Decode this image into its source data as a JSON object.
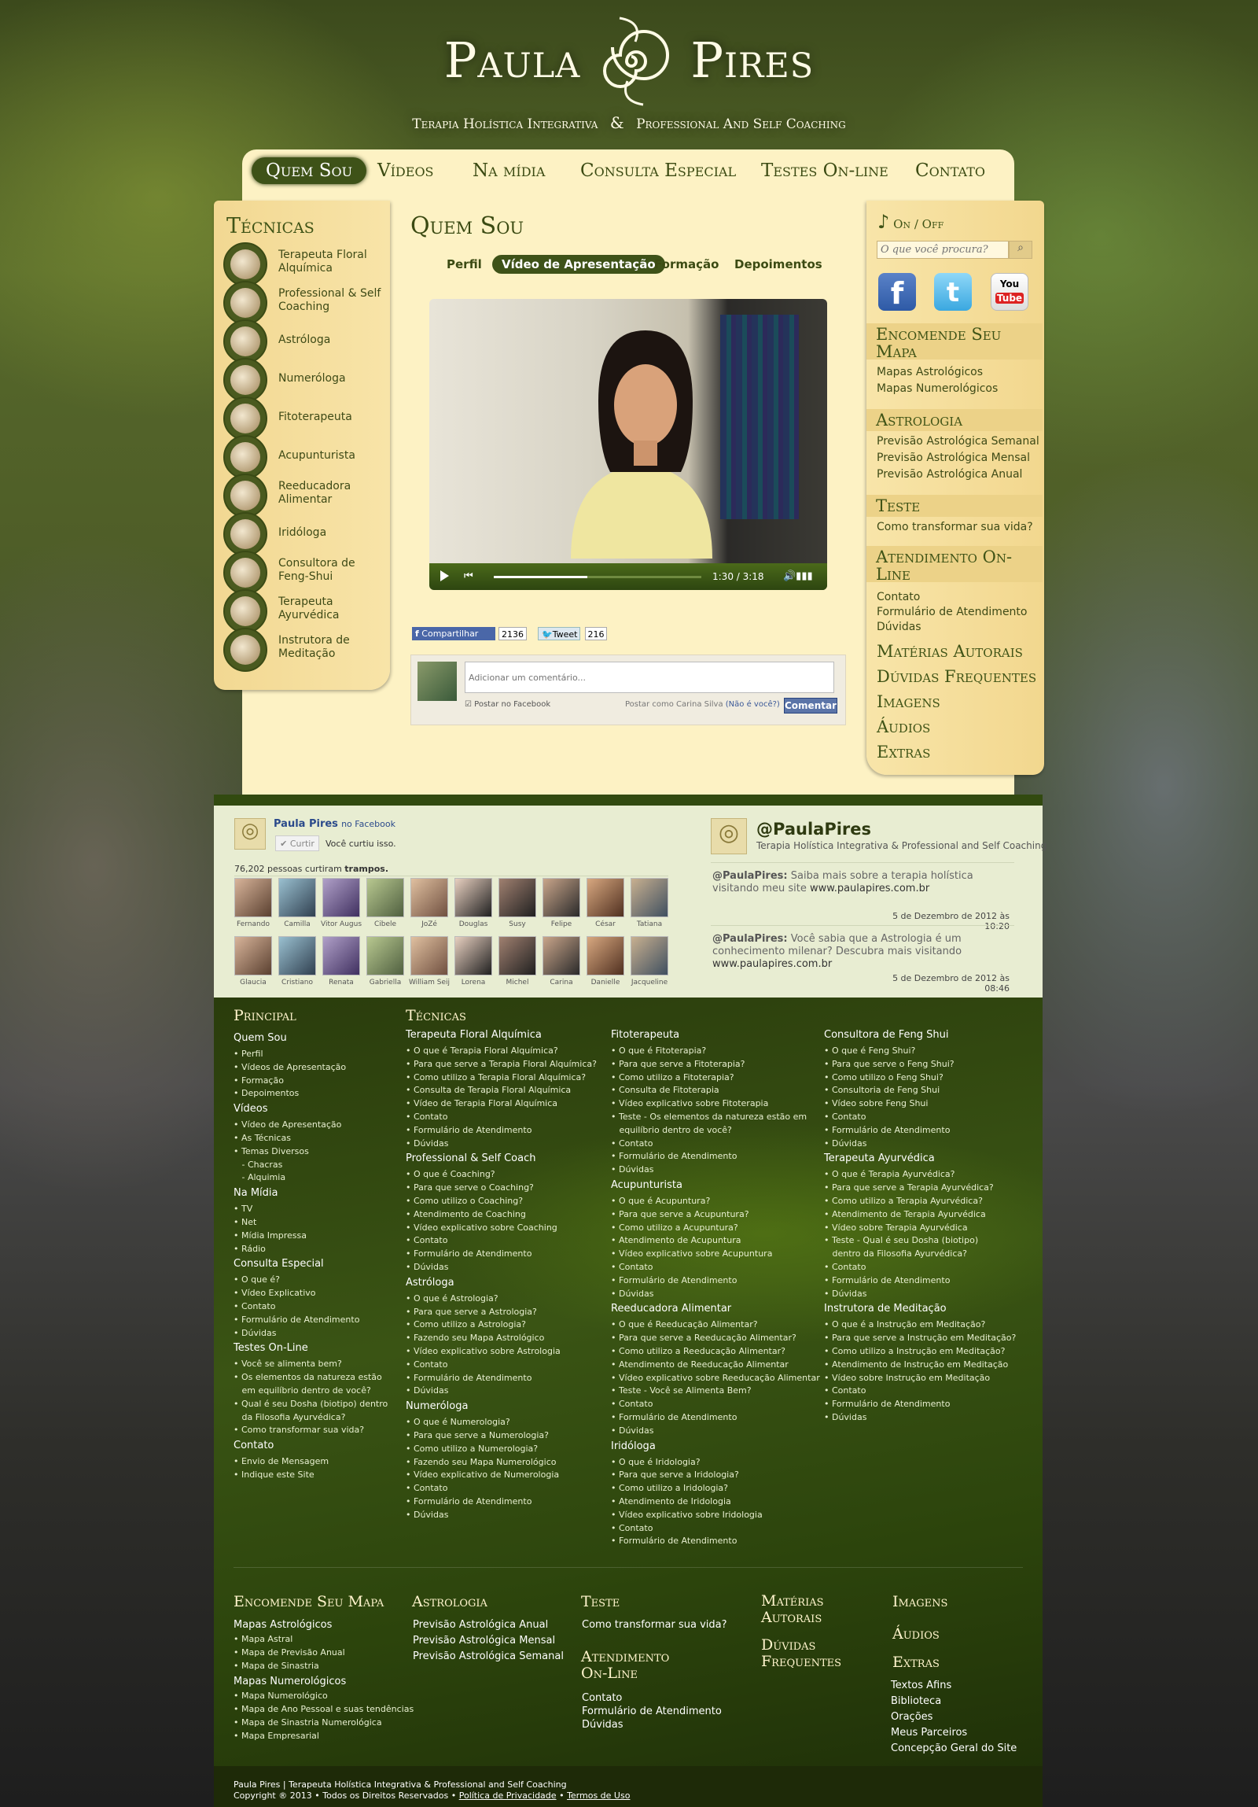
{
  "header": {
    "brand_left": "Paula",
    "brand_right": "Pires",
    "tagline_left": "Terapia Holística Integrativa",
    "tagline_amp": "&",
    "tagline_right": "Professional And Self Coaching"
  },
  "nav": {
    "items": [
      "Quem Sou",
      "Vídeos",
      "Na mídia",
      "Consulta Especial",
      "Testes On-line",
      "Contato"
    ]
  },
  "left_sidebar": {
    "title": "Técnicas",
    "items": [
      "Terapeuta Floral Alquímica",
      "Professional & Self Coaching",
      "Astróloga",
      "Numeróloga",
      "Fitoterapeuta",
      "Acupunturista",
      "Reeducadora Alimentar",
      "Iridóloga",
      "Consultora de Feng-Shui",
      "Terapeuta Ayurvédica",
      "Instrutora de Meditação"
    ]
  },
  "main": {
    "title": "Quem Sou",
    "tabs": [
      "Perfil",
      "Vídeo de Apresentação",
      "Formação",
      "Depoimentos"
    ],
    "video_time": "1:30 / 3:18",
    "video_progress": 0.45,
    "share_label": "Compartilhar",
    "share_count": "2136",
    "tweet_label": "Tweet",
    "tweet_count": "216",
    "comment_placeholder": "Adicionar um comentário...",
    "post_fb": "Postar no Facebook",
    "post_as": "Postar como Carina Silva",
    "not_you": "(Não é você?)",
    "comment_button": "Comentar"
  },
  "right_sidebar": {
    "music_on": "On",
    "music_sep": "/",
    "music_off": "Off",
    "search_placeholder": "O que você procura?",
    "sections": [
      {
        "title": "Encomende Seu Mapa",
        "links": [
          "Mapas Astrológicos",
          "Mapas Numerológicos"
        ]
      },
      {
        "title": "Astrologia",
        "links": [
          "Previsão Astrológica Semanal",
          "Previsão Astrológica Mensal",
          "Previsão Astrológica Anual"
        ]
      },
      {
        "title": "Teste",
        "links": [
          "Como transformar sua vida?"
        ]
      },
      {
        "title": "Atendimento On-Line",
        "links": [
          "Contato",
          "Formulário de Atendimento",
          "Dúvidas"
        ]
      }
    ],
    "big_links": [
      "Matérias Autorais",
      "Dúvidas Frequentes",
      "Imagens",
      "Áudios",
      "Extras"
    ]
  },
  "facebook": {
    "page": "Paula Pires",
    "on": "no Facebook",
    "like": "Curtir",
    "liked": "Você curtiu isso.",
    "count_text": "76,202 pessoas curtiram",
    "count_bold": "trampos.",
    "people": [
      "Fernando",
      "Camilla",
      "Vitor Augus",
      "Cibele",
      "JoZé",
      "Douglas",
      "Susy",
      "Felipe",
      "César",
      "Tatiana",
      "Glaucia",
      "Cristiano",
      "Renata",
      "Gabriella",
      "William Seij",
      "Lorena",
      "Michel",
      "Carina",
      "Danielle",
      "Jacqueline"
    ]
  },
  "twitter": {
    "handle": "@PaulaPires",
    "desc": "Terapia Holística Integrativa & Professional and Self Coaching",
    "tweets": [
      {
        "user": "@PaulaPires:",
        "text": "Saiba mais sobre a terapia holística visitando meu site",
        "link": "www.paulapires.com.br",
        "date": "5 de Dezembro de 2012 às 10:20"
      },
      {
        "user": "@PaulaPires:",
        "text": "Você sabia que a Astrologia é um conhecimento milenar? Descubra mais visitando",
        "link": "www.paulapires.com.br",
        "date": "5 de Dezembro de 2012 às 08:46"
      }
    ]
  },
  "footer": {
    "principal_title": "Principal",
    "tecnicas_title": "Técnicas",
    "principal": [
      {
        "h": "Quem Sou",
        "l": [
          "• Perfil",
          "• Vídeos de Apresentação",
          "• Formação",
          "• Depoimentos"
        ]
      },
      {
        "h": "Vídeos",
        "l": [
          "• Vídeo de Apresentação",
          "• As Técnicas",
          "• Temas Diversos",
          "   - Chacras",
          "   - Alquimia"
        ]
      },
      {
        "h": "Na Mídia",
        "l": [
          "• TV",
          "• Net",
          "• Mídia Impressa",
          "• Rádio"
        ]
      },
      {
        "h": "Consulta Especial",
        "l": [
          "• O que é?",
          "• Vídeo Explicativo",
          "• Contato",
          "• Formulário de Atendimento",
          "• Dúvidas"
        ]
      },
      {
        "h": "Testes On-Line",
        "l": [
          "• Você se alimenta bem?",
          "• Os elementos da natureza estão",
          "   em equilíbrio dentro de você?",
          "• Qual é seu Dosha (biotipo) dentro",
          "   da Filosofia Ayurvédica?",
          "• Como transformar sua vida?"
        ]
      },
      {
        "h": "Contato",
        "l": [
          "• Envio de Mensagem",
          "• Indique este Site"
        ]
      }
    ],
    "col1": [
      {
        "h": "Terapeuta Floral Alquímica",
        "l": [
          "• O que é Terapia Floral Alquímica?",
          "• Para que serve a Terapia Floral Alquímica?",
          "• Como utilizo a Terapia Floral Alquímica?",
          "• Consulta de Terapia Floral Alquímica",
          "• Vídeo de Terapia Floral Alquímica",
          "• Contato",
          "• Formulário de Atendimento",
          "• Dúvidas"
        ]
      },
      {
        "h": "Professional & Self Coach",
        "l": [
          "• O que é Coaching?",
          "• Para que serve o Coaching?",
          "• Como utilizo o Coaching?",
          "• Atendimento de Coaching",
          "• Vídeo explicativo sobre Coaching",
          "• Contato",
          "• Formulário de Atendimento",
          "• Dúvidas"
        ]
      },
      {
        "h": "Astróloga",
        "l": [
          "• O que é Astrologia?",
          "• Para que serve a Astrologia?",
          "• Como utilizo a Astrologia?",
          "• Fazendo seu Mapa Astrológico",
          "• Vídeo explicativo sobre Astrologia",
          "• Contato",
          "• Formulário de Atendimento",
          "• Dúvidas"
        ]
      },
      {
        "h": "Numeróloga",
        "l": [
          "• O que é Numerologia?",
          "• Para que serve a Numerologia?",
          "• Como utilizo a Numerologia?",
          "• Fazendo seu Mapa Numerológico",
          "• Vídeo explicativo de Numerologia",
          "• Contato",
          "• Formulário de Atendimento",
          "• Dúvidas"
        ]
      }
    ],
    "col2": [
      {
        "h": "Fitoterapeuta",
        "l": [
          "• O que é Fitoterapia?",
          "• Para que serve a Fitoterapia?",
          "• Como utilizo a Fitoterapia?",
          "• Consulta de Fitoterapia",
          "• Vídeo explicativo sobre Fitoterapia",
          "• Teste - Os elementos da natureza estão em",
          "   equilíbrio dentro de você?",
          "• Contato",
          "• Formulário de Atendimento",
          "• Dúvidas"
        ]
      },
      {
        "h": "Acupunturista",
        "l": [
          "• O que é Acupuntura?",
          "• Para que serve a Acupuntura?",
          "• Como utilizo a Acupuntura?",
          "• Atendimento de Acupuntura",
          "• Vídeo explicativo sobre Acupuntura",
          "• Contato",
          "• Formulário de Atendimento",
          "• Dúvidas"
        ]
      },
      {
        "h": "Reeducadora Alimentar",
        "l": [
          "• O que é Reeducação Alimentar?",
          "• Para que serve a Reeducação Alimentar?",
          "• Como utilizo a Reeducação Alimentar?",
          "• Atendimento de Reeducação Alimentar",
          "• Vídeo explicativo sobre Reeducação Alimentar",
          "• Teste - Você se Alimenta Bem?",
          "• Contato",
          "• Formulário de Atendimento",
          "• Dúvidas"
        ]
      },
      {
        "h": "Iridóloga",
        "l": [
          "• O que é Iridologia?",
          "• Para que serve a Iridologia?",
          "• Como utilizo a Iridologia?",
          "• Atendimento de Iridologia",
          "• Vídeo explicativo sobre Iridologia",
          "• Contato",
          "• Formulário de Atendimento"
        ]
      }
    ],
    "col3": [
      {
        "h": "Consultora de Feng Shui",
        "l": [
          "• O que é Feng Shui?",
          "• Para que serve o Feng Shui?",
          "• Como utilizo o Feng Shui?",
          "• Consultoria de Feng Shui",
          "• Vídeo sobre Feng Shui",
          "• Contato",
          "• Formulário de Atendimento",
          "• Dúvidas"
        ]
      },
      {
        "h": "Terapeuta Ayurvédica",
        "l": [
          "• O que é Terapia Ayurvédica?",
          "• Para que serve a Terapia Ayurvédica?",
          "• Como utilizo a Terapia Ayurvédica?",
          "• Atendimento de Terapia Ayurvédica",
          "• Vídeo sobre Terapia Ayurvédica",
          "• Teste - Qual é seu Dosha (biotipo)",
          "   dentro da Filosofia Ayurvédica?",
          "• Contato",
          "• Formulário de Atendimento",
          "• Dúvidas"
        ]
      },
      {
        "h": "Instrutora de Meditação",
        "l": [
          "• O que é a Instrução em Meditação?",
          "• Para que serve a Instrução em Meditação?",
          "• Como utilizo a Instrução em Meditação?",
          "• Atendimento de Instrução em Meditação",
          "• Vídeo sobre Instrução em Meditação",
          "• Contato",
          "• Formulário de Atendimento",
          "• Dúvidas"
        ]
      }
    ],
    "bottom": {
      "mapa_title": "Encomende Seu Mapa",
      "mapa_a": "Mapas Astrológicos",
      "mapa_a_l": [
        "• Mapa Astral",
        "• Mapa de Previsão Anual",
        "• Mapa de Sinastria"
      ],
      "mapa_n": "Mapas Numerológicos",
      "mapa_n_l": [
        "• Mapa Numerológico",
        "• Mapa de Ano Pessoal e suas tendências",
        "• Mapa de Sinastria Numerológica",
        "• Mapa Empresarial"
      ],
      "astro_title": "Astrologia",
      "astro_l": [
        "Previsão Astrológica Anual",
        "Previsão Astrológica Mensal",
        "Previsão Astrológica Semanal"
      ],
      "teste_title": "Teste",
      "teste_l": "Como transformar sua vida?",
      "atend_title1": "Atendimento",
      "atend_title2": "On-Line",
      "atend_l": [
        "Contato",
        "Formulário de Atendimento",
        "Dúvidas"
      ],
      "mat1": "Matérias",
      "mat2": "Autorais",
      "duv1": "Dúvidas",
      "duv2": "Frequentes",
      "imagens": "Imagens",
      "audios": "Áudios",
      "extras": "Extras",
      "extras_l": [
        "Textos Afins",
        "Biblioteca",
        "Orações",
        "Meus Parceiros",
        "Concepção Geral do Site"
      ]
    },
    "copy1": "Paula Pires | Terapeuta Holística Integrativa & Professional and Self Coaching",
    "copy2": "Copyright ® 2013 • Todos os Direitos Reservados •",
    "privacy": "Política de Privacidade",
    "sep": "•",
    "terms": "Termos de Uso"
  }
}
